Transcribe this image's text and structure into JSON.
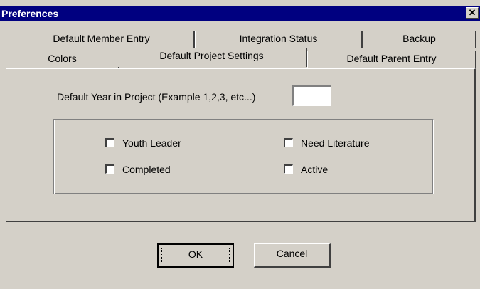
{
  "window": {
    "title": "Preferences",
    "close_glyph": "✕"
  },
  "tabs_back": [
    {
      "label": "Default Member Entry"
    },
    {
      "label": "Integration Status"
    },
    {
      "label": "Backup"
    }
  ],
  "tabs_front": [
    {
      "label": "Colors"
    },
    {
      "label": "Default Project Settings",
      "active": true
    },
    {
      "label": "Default Parent Entry"
    }
  ],
  "form": {
    "year_label": "Default Year in Project (Example 1,2,3, etc...)",
    "year_value": ""
  },
  "checkboxes": [
    {
      "label": "Youth Leader",
      "checked": false
    },
    {
      "label": "Need Literature",
      "checked": false
    },
    {
      "label": "Completed",
      "checked": false
    },
    {
      "label": "Active",
      "checked": false
    }
  ],
  "buttons": {
    "ok": "OK",
    "cancel": "Cancel"
  },
  "colors": {
    "titlebar": "#000080",
    "face": "#d4d0c8"
  }
}
